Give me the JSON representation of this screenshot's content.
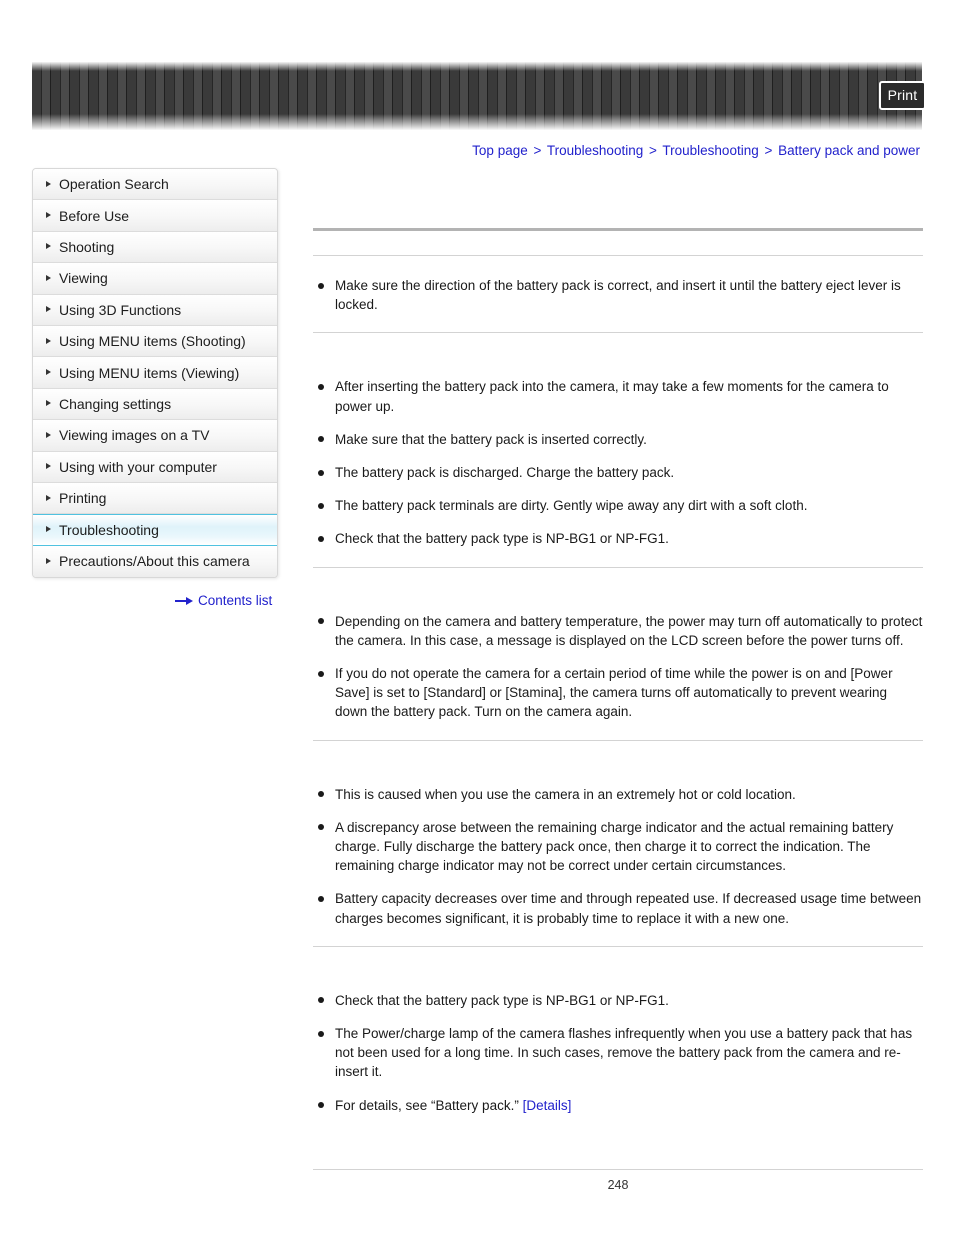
{
  "header": {
    "print_label": "Print"
  },
  "breadcrumb": {
    "separator": ">",
    "items": [
      {
        "label": "Top page"
      },
      {
        "label": "Troubleshooting"
      },
      {
        "label": "Troubleshooting"
      },
      {
        "label": "Battery pack and power"
      }
    ]
  },
  "sidebar": {
    "items": [
      {
        "label": "Operation Search",
        "active": false
      },
      {
        "label": "Before Use",
        "active": false
      },
      {
        "label": "Shooting",
        "active": false
      },
      {
        "label": "Viewing",
        "active": false
      },
      {
        "label": "Using 3D Functions",
        "active": false
      },
      {
        "label": "Using MENU items (Shooting)",
        "active": false
      },
      {
        "label": "Using MENU items (Viewing)",
        "active": false
      },
      {
        "label": "Changing settings",
        "active": false
      },
      {
        "label": "Viewing images on a TV",
        "active": false
      },
      {
        "label": "Using with your computer",
        "active": false
      },
      {
        "label": "Printing",
        "active": false
      },
      {
        "label": "Troubleshooting",
        "active": true
      },
      {
        "label": "Precautions/About this camera",
        "active": false
      }
    ],
    "contents_link": "Contents list"
  },
  "main": {
    "sections": [
      {
        "heading": "",
        "bullets": [
          "Make sure the direction of the battery pack is correct, and insert it until the battery eject lever is locked."
        ]
      },
      {
        "heading": "",
        "bullets": [
          "After inserting the battery pack into the camera, it may take a few moments for the camera to power up.",
          "Make sure that the battery pack is inserted correctly.",
          "The battery pack is discharged. Charge the battery pack.",
          "The battery pack terminals are dirty. Gently wipe away any dirt with a soft cloth.",
          "Check that the battery pack type is NP-BG1 or NP-FG1."
        ]
      },
      {
        "heading": "",
        "bullets": [
          "Depending on the camera and battery temperature, the power may turn off automatically to protect the camera. In this case, a message is displayed on the LCD screen before the power turns off.",
          "If you do not operate the camera for a certain period of time while the power is on and [Power Save] is set to [Standard] or [Stamina], the camera turns off automatically to prevent wearing down the battery pack. Turn on the camera again."
        ]
      },
      {
        "heading": "",
        "bullets": [
          "This is caused when you use the camera in an extremely hot or cold location.",
          "A discrepancy arose between the remaining charge indicator and the actual remaining battery charge. Fully discharge the battery pack once, then charge it to correct the indication. The remaining charge indicator may not be correct under certain circumstances.",
          "Battery capacity decreases over time and through repeated use. If decreased usage time between charges becomes significant, it is probably time to replace it with a new one."
        ]
      },
      {
        "heading": "",
        "bullets": [
          "Check that the battery pack type is NP-BG1 or NP-FG1.",
          "The Power/charge lamp of the camera flashes infrequently when you use a battery pack that has not been used for a long time. In such cases, remove the battery pack from the camera and re-insert it."
        ],
        "final_bullet_prefix": "For details, see “Battery pack.” ",
        "final_bullet_link": "[Details]"
      }
    ]
  },
  "footer": {
    "page_number": "248"
  },
  "colors": {
    "link": "#2222cc",
    "highlight_border": "#4fc2e0",
    "rule_thick": "#b3b3b3",
    "rule_thin": "#d3d3d3"
  }
}
